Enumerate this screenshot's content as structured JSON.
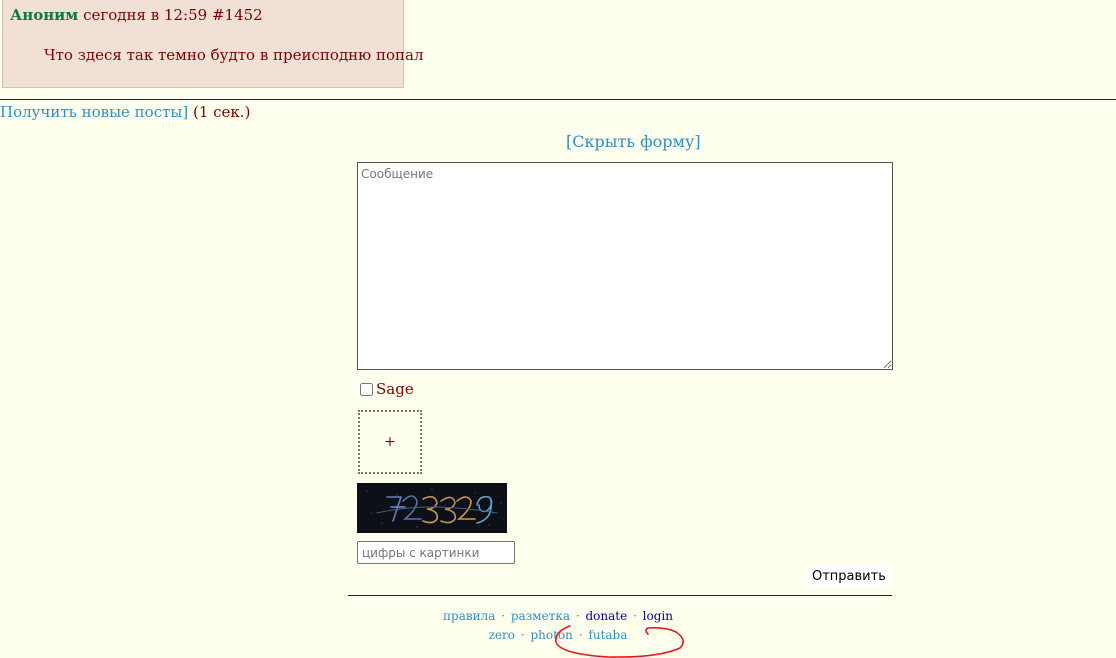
{
  "post": {
    "author": "Аноним",
    "meta": "сегодня в 12:59 #1452",
    "body": "Что здеся так темно будто в преисподню попал"
  },
  "refresh": {
    "link_label": "Получить новые посты]",
    "note": "(1 сек.)"
  },
  "form": {
    "hide_label": "[Скрыть форму]",
    "message_placeholder": "Сообщение",
    "sage_label": "Sage",
    "upload_label": "+",
    "captcha_placeholder": "цифры с картинки",
    "submit_label": "Отправить"
  },
  "footer": {
    "row1": [
      {
        "label": "правила",
        "color": "#2f8fbf"
      },
      {
        "label": "разметка",
        "color": "#2f8fbf"
      },
      {
        "label": "donate",
        "color": "#0000a0"
      },
      {
        "label": "login",
        "color": "#0000a0"
      }
    ],
    "row2": [
      {
        "label": "zero"
      },
      {
        "label": "photon"
      },
      {
        "label": "futaba"
      }
    ],
    "separator": "·"
  },
  "colors": {
    "background": "#ffffee",
    "post_background": "#f0e0d6",
    "author": "#117743",
    "text": "#800000",
    "link": "#2f8fbf",
    "annotation": "#e8161b"
  }
}
